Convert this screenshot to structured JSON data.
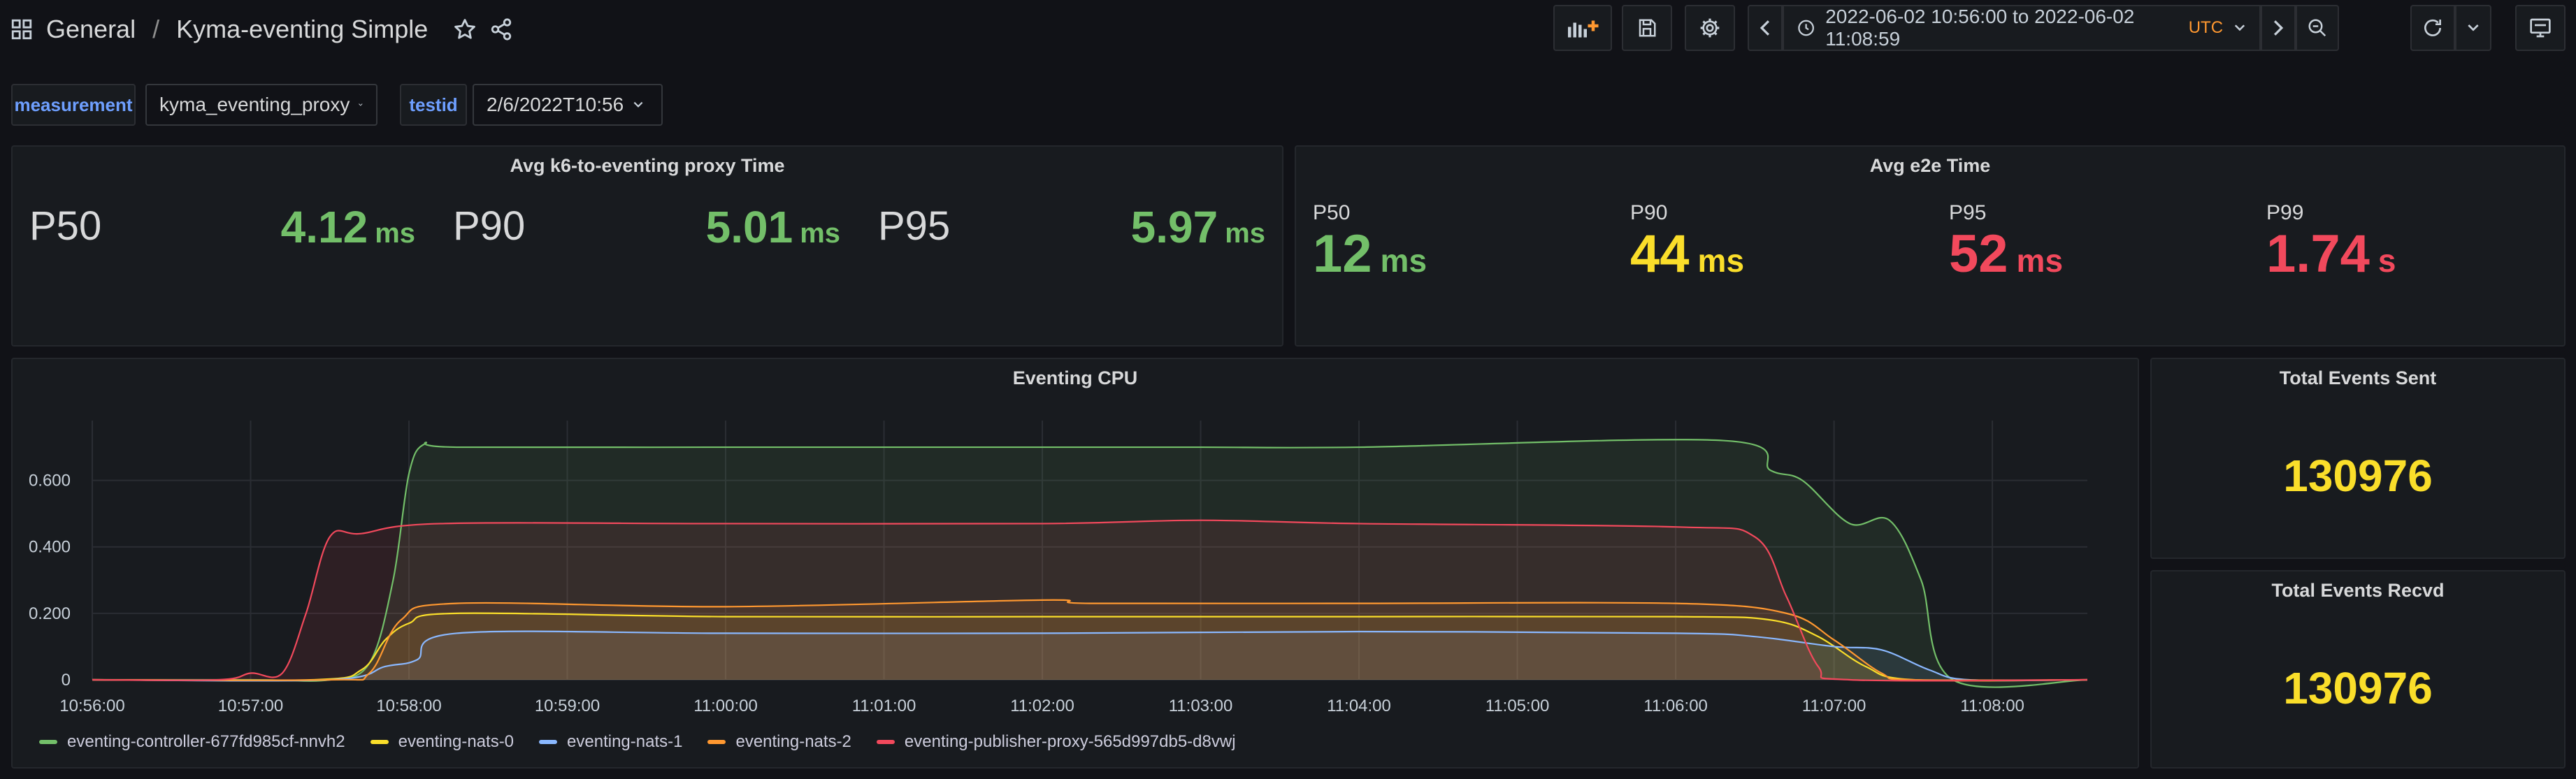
{
  "header": {
    "folder": "General",
    "separator": "/",
    "title": "Kyma-eventing Simple",
    "time_from": "2022-06-02 10:56:00",
    "time_to_word": "to",
    "time_to": "2022-06-02 11:08:59",
    "timezone": "UTC"
  },
  "variables": [
    {
      "label": "measurement",
      "value": "kyma_eventing_proxy"
    },
    {
      "label": "testid",
      "value": "2/6/2022T10:56"
    }
  ],
  "proxy_panel": {
    "title": "Avg k6-to-eventing proxy Time",
    "stats": [
      {
        "label": "P50",
        "value": "4.12",
        "unit": "ms"
      },
      {
        "label": "P90",
        "value": "5.01",
        "unit": "ms"
      },
      {
        "label": "P95",
        "value": "5.97",
        "unit": "ms"
      }
    ]
  },
  "e2e_panel": {
    "title": "Avg e2e Time",
    "stats": [
      {
        "label": "P50",
        "value": "12",
        "unit": "ms",
        "color": "#73bf69"
      },
      {
        "label": "P90",
        "value": "44",
        "unit": "ms",
        "color": "#fade2a"
      },
      {
        "label": "P95",
        "value": "52",
        "unit": "ms",
        "color": "#f2495c"
      },
      {
        "label": "P99",
        "value": "1.74",
        "unit": "s",
        "color": "#f2495c"
      }
    ]
  },
  "sent_panel": {
    "title": "Total Events Sent",
    "value": "130976"
  },
  "recvd_panel": {
    "title": "Total Events Recvd",
    "value": "130976"
  },
  "cpu_panel": {
    "title": "Eventing CPU"
  },
  "chart_data": {
    "type": "area",
    "title": "Eventing CPU",
    "xlabel": "",
    "ylabel": "",
    "x_ticks": [
      "10:56:00",
      "10:57:00",
      "10:58:00",
      "10:59:00",
      "11:00:00",
      "11:01:00",
      "11:02:00",
      "11:03:00",
      "11:04:00",
      "11:05:00",
      "11:06:00",
      "11:07:00",
      "11:08:00"
    ],
    "y_ticks": [
      "0",
      "0.200",
      "0.400",
      "0.600"
    ],
    "x_range_minutes": [
      0,
      12.6
    ],
    "ylim": [
      0,
      0.78
    ],
    "grid": true,
    "legend_position": "bottom",
    "series": [
      {
        "name": "eventing-controller-677fd985cf-nnvh2",
        "color": "#73bf69",
        "points": [
          [
            0,
            0
          ],
          [
            1,
            0
          ],
          [
            1.5,
            0
          ],
          [
            1.75,
            0.05
          ],
          [
            1.9,
            0.3
          ],
          [
            2.0,
            0.62
          ],
          [
            2.1,
            0.71
          ],
          [
            2.3,
            0.7
          ],
          [
            4,
            0.7
          ],
          [
            6,
            0.7
          ],
          [
            7,
            0.7
          ],
          [
            8,
            0.7
          ],
          [
            10.3,
            0.72
          ],
          [
            10.6,
            0.63
          ],
          [
            10.8,
            0.6
          ],
          [
            11.1,
            0.47
          ],
          [
            11.35,
            0.48
          ],
          [
            11.55,
            0.3
          ],
          [
            11.75,
            0
          ],
          [
            12.6,
            0
          ]
        ]
      },
      {
        "name": "eventing-nats-0",
        "color": "#fade2a",
        "points": [
          [
            0,
            0
          ],
          [
            1.4,
            0
          ],
          [
            1.7,
            0.03
          ],
          [
            1.85,
            0.12
          ],
          [
            2.0,
            0.17
          ],
          [
            2.3,
            0.2
          ],
          [
            4,
            0.19
          ],
          [
            6,
            0.19
          ],
          [
            8,
            0.19
          ],
          [
            10,
            0.19
          ],
          [
            10.6,
            0.18
          ],
          [
            10.9,
            0.13
          ],
          [
            11.2,
            0.04
          ],
          [
            11.5,
            0
          ],
          [
            12.6,
            0
          ]
        ]
      },
      {
        "name": "eventing-nats-1",
        "color": "#8ab8ff",
        "points": [
          [
            0,
            0
          ],
          [
            1.5,
            0
          ],
          [
            1.85,
            0.04
          ],
          [
            2.05,
            0.06
          ],
          [
            2.3,
            0.14
          ],
          [
            4,
            0.14
          ],
          [
            6,
            0.14
          ],
          [
            8,
            0.145
          ],
          [
            10,
            0.14
          ],
          [
            10.5,
            0.13
          ],
          [
            11,
            0.1
          ],
          [
            11.3,
            0.09
          ],
          [
            11.6,
            0.03
          ],
          [
            11.85,
            0
          ],
          [
            12.6,
            0
          ]
        ]
      },
      {
        "name": "eventing-nats-2",
        "color": "#ff9830",
        "points": [
          [
            0,
            0
          ],
          [
            1.5,
            0
          ],
          [
            1.75,
            0.02
          ],
          [
            1.95,
            0.18
          ],
          [
            2.3,
            0.23
          ],
          [
            4,
            0.22
          ],
          [
            6,
            0.24
          ],
          [
            6.3,
            0.23
          ],
          [
            8,
            0.23
          ],
          [
            10,
            0.23
          ],
          [
            10.7,
            0.2
          ],
          [
            11.0,
            0.12
          ],
          [
            11.3,
            0.02
          ],
          [
            11.5,
            0
          ],
          [
            12.6,
            0
          ]
        ]
      },
      {
        "name": "eventing-publisher-proxy-565d997db5-d8vwj",
        "color": "#f2495c",
        "points": [
          [
            0,
            0
          ],
          [
            0.8,
            0
          ],
          [
            1.0,
            0.02
          ],
          [
            1.2,
            0.02
          ],
          [
            1.35,
            0.2
          ],
          [
            1.5,
            0.43
          ],
          [
            1.7,
            0.44
          ],
          [
            2.2,
            0.47
          ],
          [
            4,
            0.47
          ],
          [
            6,
            0.47
          ],
          [
            7,
            0.48
          ],
          [
            8,
            0.47
          ],
          [
            10,
            0.46
          ],
          [
            10.5,
            0.43
          ],
          [
            10.7,
            0.25
          ],
          [
            10.9,
            0.04
          ],
          [
            11.1,
            0
          ],
          [
            12.6,
            0
          ]
        ]
      }
    ]
  }
}
